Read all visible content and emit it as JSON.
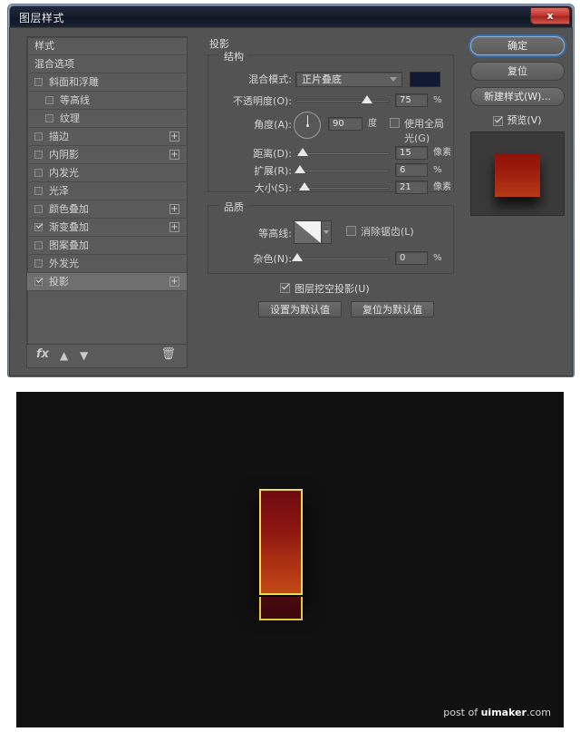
{
  "window": {
    "title": "图层样式",
    "close_label": "x"
  },
  "style_list": {
    "items": [
      {
        "label": "样式",
        "type": "header",
        "checked": null,
        "plus": false,
        "selected": false
      },
      {
        "label": "混合选项",
        "type": "header",
        "checked": null,
        "plus": false,
        "selected": false
      },
      {
        "label": "斜面和浮雕",
        "type": "check",
        "checked": false,
        "plus": false,
        "selected": false
      },
      {
        "label": "等高线",
        "type": "check",
        "checked": false,
        "plus": false,
        "selected": false,
        "indent": true
      },
      {
        "label": "纹理",
        "type": "check",
        "checked": false,
        "plus": false,
        "selected": false,
        "indent": true
      },
      {
        "label": "描边",
        "type": "check",
        "checked": false,
        "plus": true,
        "selected": false
      },
      {
        "label": "内阴影",
        "type": "check",
        "checked": false,
        "plus": true,
        "selected": false
      },
      {
        "label": "内发光",
        "type": "check",
        "checked": false,
        "plus": false,
        "selected": false
      },
      {
        "label": "光泽",
        "type": "check",
        "checked": false,
        "plus": false,
        "selected": false
      },
      {
        "label": "颜色叠加",
        "type": "check",
        "checked": false,
        "plus": true,
        "selected": false
      },
      {
        "label": "渐变叠加",
        "type": "check",
        "checked": true,
        "plus": true,
        "selected": false
      },
      {
        "label": "图案叠加",
        "type": "check",
        "checked": false,
        "plus": false,
        "selected": false
      },
      {
        "label": "外发光",
        "type": "check",
        "checked": false,
        "plus": false,
        "selected": false
      },
      {
        "label": "投影",
        "type": "check",
        "checked": true,
        "plus": true,
        "selected": true
      }
    ],
    "toolbar": {
      "fx": "fx",
      "move_up": "▲",
      "move_down": "▼",
      "delete": "🗑"
    }
  },
  "panel": {
    "title": "投影",
    "structure": {
      "legend": "结构",
      "blend_mode_label": "混合模式:",
      "blend_mode_value": "正片叠底",
      "shadow_color": "#101a33",
      "opacity_label": "不透明度(O):",
      "opacity_value": "75",
      "opacity_unit": "%",
      "opacity_pct": 75,
      "angle_label": "角度(A):",
      "angle_value": "90",
      "angle_unit": "度",
      "use_global_light_label": "使用全局光(G)",
      "use_global_light_checked": false,
      "distance_label": "距离(D):",
      "distance_value": "15",
      "distance_unit": "像素",
      "distance_pct": 7,
      "spread_label": "扩展(R):",
      "spread_value": "6",
      "spread_unit": "%",
      "spread_pct": 4,
      "size_label": "大小(S):",
      "size_value": "21",
      "size_unit": "像素",
      "size_pct": 9
    },
    "quality": {
      "legend": "品质",
      "contour_label": "等高线:",
      "antialias_label": "消除锯齿(L)",
      "antialias_checked": false,
      "noise_label": "杂色(N):",
      "noise_value": "0",
      "noise_unit": "%",
      "noise_pct": 1,
      "knockout_label": "图层挖空投影(U)",
      "knockout_checked": true,
      "set_default_button": "设置为默认值",
      "reset_default_button": "复位为默认值"
    }
  },
  "right": {
    "ok_button": "确定",
    "reset_button": "复位",
    "new_style_button": "新建样式(W)...",
    "preview_label": "预览(V)",
    "preview_checked": true
  },
  "canvas": {
    "watermark_prefix": "post of ",
    "watermark_brand": "uimaker",
    "watermark_suffix": ".com"
  }
}
